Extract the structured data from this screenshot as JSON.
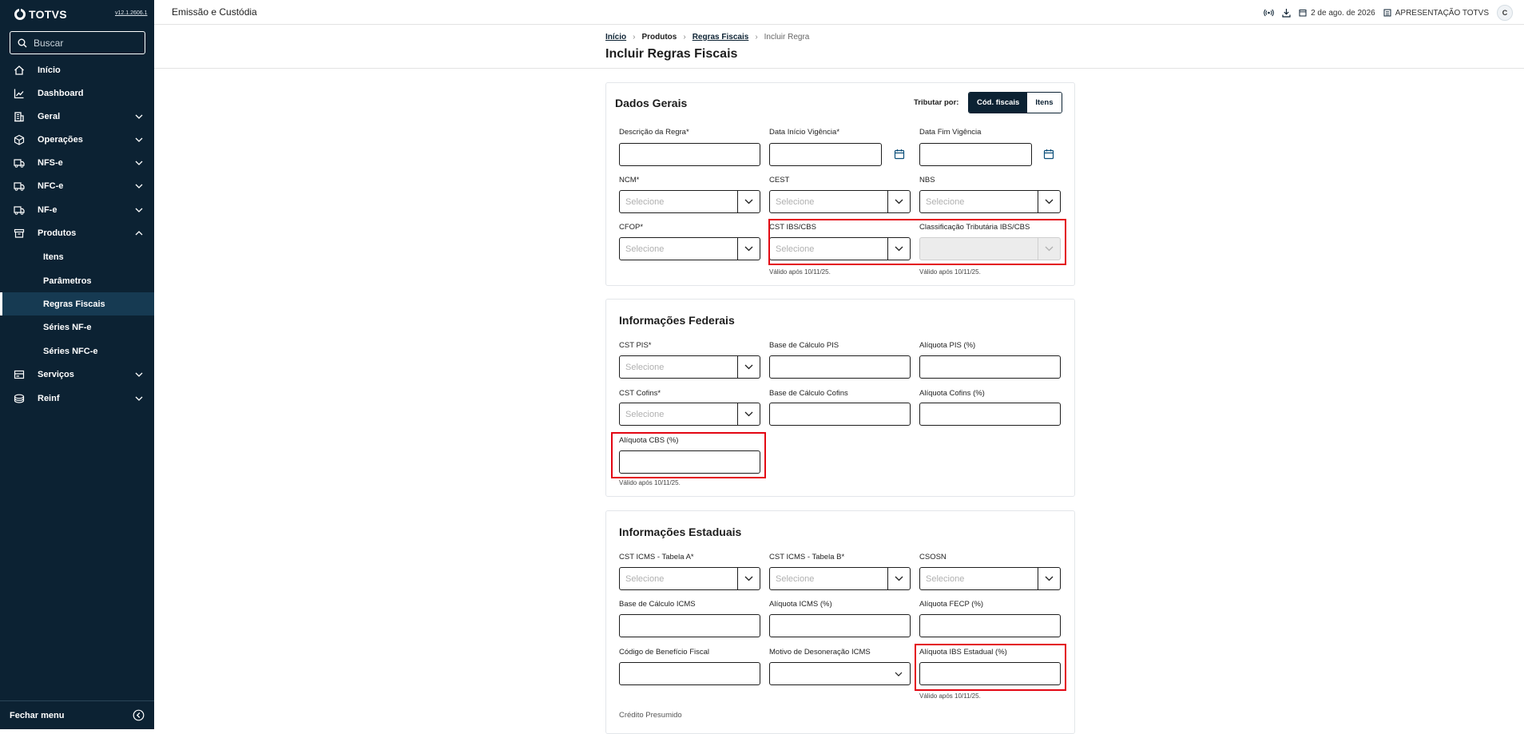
{
  "sidebar": {
    "brand": "TOTVS",
    "version": "v12.1.2606.1",
    "search_placeholder": "Buscar",
    "items": [
      {
        "label": "Início",
        "icon": "home-icon"
      },
      {
        "label": "Dashboard",
        "icon": "chart-line-icon"
      },
      {
        "label": "Geral",
        "icon": "building-icon"
      },
      {
        "label": "Operações",
        "icon": "cube-icon"
      },
      {
        "label": "NFS-e",
        "icon": "truck-icon"
      },
      {
        "label": "NFC-e",
        "icon": "truck-icon"
      },
      {
        "label": "NF-e",
        "icon": "truck-icon"
      },
      {
        "label": "Produtos",
        "icon": "archive-icon"
      },
      {
        "label": "Serviços",
        "icon": "card-icon"
      },
      {
        "label": "Reinf",
        "icon": "coins-icon"
      }
    ],
    "subitems": [
      "Itens",
      "Parâmetros",
      "Regras Fiscais",
      "Séries NF-e",
      "Séries NFC-e"
    ],
    "footer": "Fechar menu"
  },
  "topbar": {
    "title": "Emissão e Custódia",
    "date": "2 de ago. de 2026",
    "company": "APRESENTAÇÃO TOTVS",
    "avatar": "C"
  },
  "breadcrumb": [
    "Início",
    "Produtos",
    "Regras Fiscais",
    "Incluir Regra"
  ],
  "page_title": "Incluir Regras Fiscais",
  "dados_gerais": {
    "title": "Dados Gerais",
    "tributar_label": "Tributar por:",
    "tributar_options": [
      "Cód. fiscais",
      "Itens"
    ],
    "fields": {
      "descricao": "Descrição da Regra*",
      "data_inicio": "Data Início Vigência*",
      "data_fim": "Data Fim Vigência",
      "ncm": "NCM*",
      "cest": "CEST",
      "nbs": "NBS",
      "cfop": "CFOP*",
      "cst_ibs": "CST IBS/CBS",
      "class_trib": "Classificação Tributária IBS/CBS"
    },
    "placeholder": "Selecione",
    "hint": "Válido após 10/11/25."
  },
  "federais": {
    "title": "Informações Federais",
    "fields": {
      "cst_pis": "CST PIS*",
      "base_pis": "Base de Cálculo PIS",
      "aliq_pis": "Alíquota PIS (%)",
      "cst_cofins": "CST Cofins*",
      "base_cofins": "Base de Cálculo Cofins",
      "aliq_cofins": "Alíquota Cofins (%)",
      "aliq_cbs": "Alíquota CBS (%)"
    },
    "hint": "Válido após 10/11/25."
  },
  "estaduais": {
    "title": "Informações Estaduais",
    "fields": {
      "cst_a": "CST ICMS - Tabela A*",
      "cst_b": "CST ICMS - Tabela B*",
      "csosn": "CSOSN",
      "base_icms": "Base de Cálculo ICMS",
      "aliq_icms": "Alíquota ICMS (%)",
      "aliq_fecp": "Alíquota FECP (%)",
      "cod_beneficio": "Código de Benefício Fiscal",
      "motivo_deson": "Motivo de Desoneração ICMS",
      "aliq_ibs": "Alíquota IBS Estadual (%)",
      "credito": "Crédito Presumido"
    },
    "hint": "Válido após 10/11/25."
  },
  "colors": {
    "sidebar": "#0c2233",
    "highlight": "#e30613"
  }
}
